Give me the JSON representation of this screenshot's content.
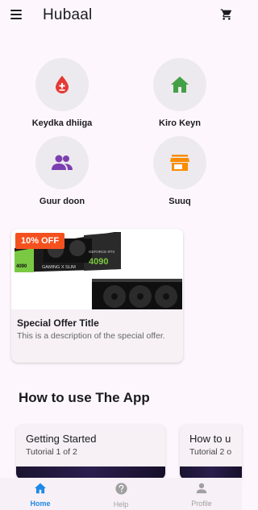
{
  "appbar": {
    "title": "Hubaal"
  },
  "categories": [
    {
      "label": "Keydka dhiiga",
      "icon": "blood-drop-icon",
      "color": "#e53935"
    },
    {
      "label": "Kiro Keyn",
      "icon": "home-icon",
      "color": "#43a047"
    },
    {
      "label": "Guur doon",
      "icon": "people-icon",
      "color": "#7b3fb0"
    },
    {
      "label": "Suuq",
      "icon": "store-icon",
      "color": "#fb8c00"
    }
  ],
  "offer": {
    "badge": "10% OFF",
    "title": "Special Offer Title",
    "description": "This is a description of the special offer.",
    "image_text": {
      "brand": "GAMING X SLIM",
      "model": "4090",
      "series": "GEFORCE RTX"
    }
  },
  "tutorials": {
    "section_title": "How to use The App",
    "cards": [
      {
        "title": "Getting Started",
        "subtitle": "Tutorial 1 of 2"
      },
      {
        "title": "How to u",
        "subtitle": "Tutorial 2 o"
      }
    ]
  },
  "bottom_nav": {
    "items": [
      {
        "label": "Home",
        "active": true
      },
      {
        "label": "Help",
        "active": false
      },
      {
        "label": "Profile",
        "active": false
      }
    ]
  },
  "colors": {
    "accent": "#1e88e5",
    "background": "#fdf7fd",
    "badge": "#f4511e"
  }
}
